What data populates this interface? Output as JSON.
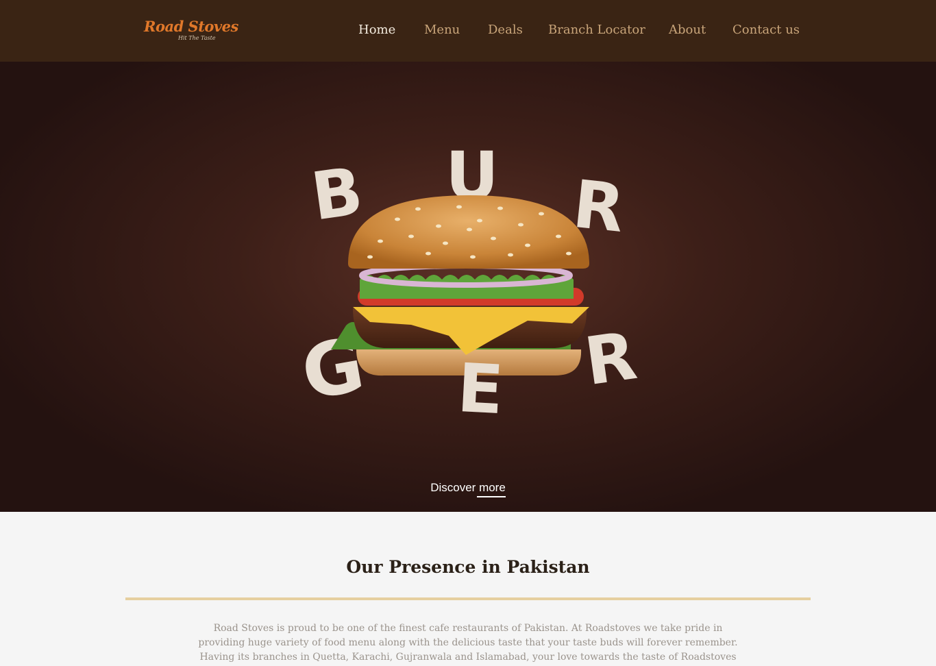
{
  "brand": {
    "name": "Road Stoves",
    "tagline": "Hit The Taste"
  },
  "nav": {
    "items": [
      {
        "label": "Home"
      },
      {
        "label": "Menu"
      },
      {
        "label": "Deals"
      },
      {
        "label": "Branch Locator"
      },
      {
        "label": "About"
      },
      {
        "label": "Contact us"
      }
    ]
  },
  "hero": {
    "letters": [
      "B",
      "U",
      "R",
      "G",
      "E",
      "R"
    ],
    "cta": {
      "label_part1": "Discover ",
      "label_part2": "more"
    }
  },
  "presence": {
    "title": "Our Presence in Pakistan",
    "body": "Road Stoves is proud to be one of the finest cafe restaurants of Pakistan. At Roadstoves we take pride in providing huge variety of food menu along with the delicious taste that your taste buds will forever remember. Having its branches in Quetta, Karachi, Gujranwala and Islamabad, your love towards the taste of Roadstoves makes us expand"
  },
  "colors": {
    "header_bg": "#3a2414",
    "brand_orange": "#e0782a",
    "nav_link": "#c9a57a",
    "nav_active": "#f4ecdf",
    "rule": "#e6cf9f"
  }
}
